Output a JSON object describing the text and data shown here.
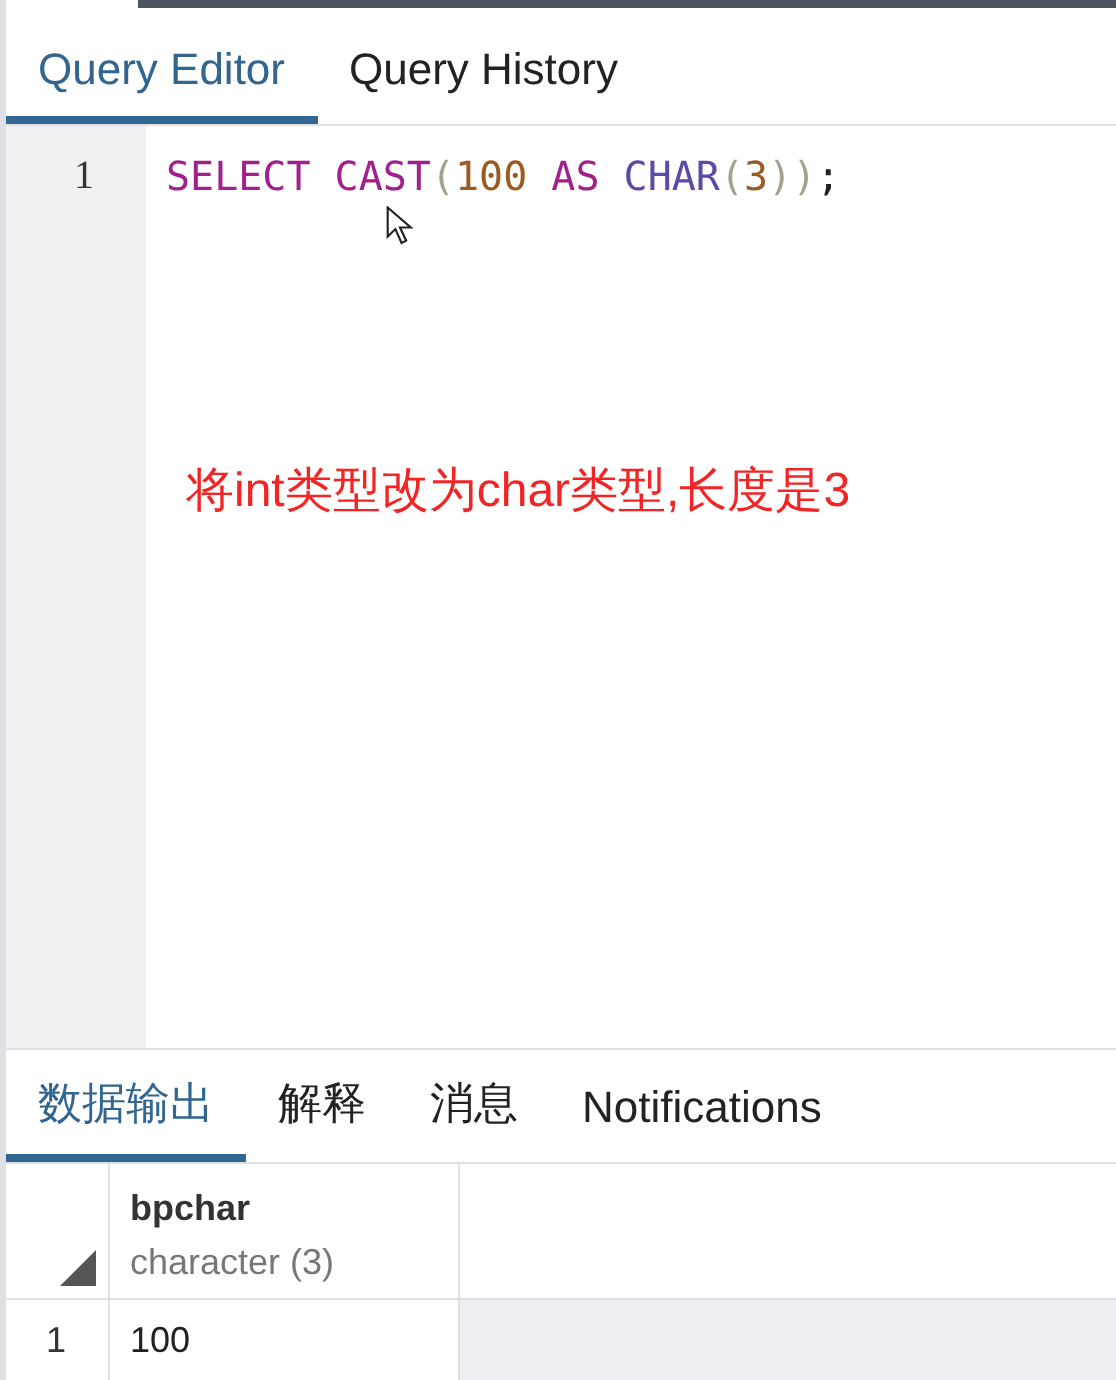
{
  "editor_tabs": [
    {
      "label": "Query Editor",
      "selected": true
    },
    {
      "label": "Query History",
      "selected": false
    }
  ],
  "editor": {
    "lines": [
      {
        "number": "1",
        "tokens": [
          {
            "kind": "keyword",
            "text": "SELECT"
          },
          {
            "kind": "space"
          },
          {
            "kind": "keyword",
            "text": "CAST"
          },
          {
            "kind": "paren",
            "text": "("
          },
          {
            "kind": "number",
            "text": "100"
          },
          {
            "kind": "space"
          },
          {
            "kind": "keyword",
            "text": "AS"
          },
          {
            "kind": "space"
          },
          {
            "kind": "type",
            "text": "CHAR"
          },
          {
            "kind": "paren",
            "text": "("
          },
          {
            "kind": "number",
            "text": "3"
          },
          {
            "kind": "paren",
            "text": "))"
          },
          {
            "kind": "punct",
            "text": ";"
          }
        ]
      }
    ],
    "annotation": "将int类型改为char类型,长度是3"
  },
  "output_tabs": [
    {
      "label": "数据输出",
      "selected": true
    },
    {
      "label": "解释",
      "selected": false
    },
    {
      "label": "消息",
      "selected": false
    },
    {
      "label": "Notifications",
      "selected": false
    }
  ],
  "table": {
    "columns": [
      {
        "name": "bpchar",
        "type": "character (3)"
      }
    ],
    "rows": [
      {
        "number": "1",
        "cells": [
          "100"
        ]
      }
    ]
  }
}
